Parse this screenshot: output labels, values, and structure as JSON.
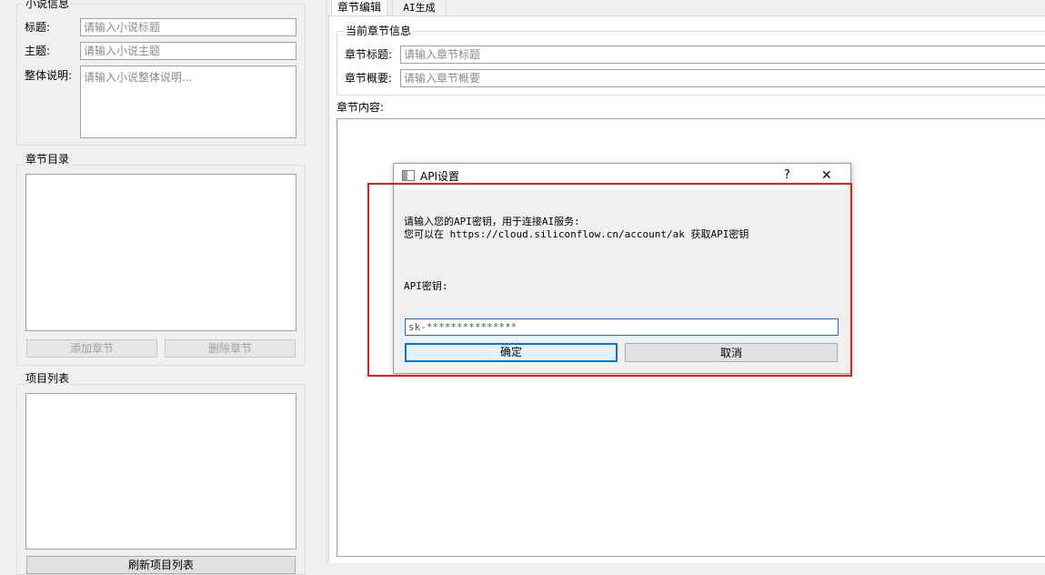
{
  "left_panel": {
    "novel_info": {
      "title": "小说信息",
      "title_label": "标题:",
      "title_placeholder": "请输入小说标题",
      "theme_label": "主题:",
      "theme_placeholder": "请输入小说主题",
      "desc_label": "整体说明:",
      "desc_placeholder": "请输入小说整体说明..."
    },
    "chapter_toc": {
      "title": "章节目录",
      "add_button": "添加章节",
      "delete_button": "删除章节"
    },
    "project_list": {
      "title": "项目列表",
      "bottom_button": "刷新项目列表"
    }
  },
  "right_panel": {
    "tabs": [
      {
        "label": "章节编辑",
        "active": true
      },
      {
        "label": "AI生成",
        "active": false
      }
    ],
    "current_chapter": {
      "title": "当前章节信息",
      "chapter_title_label": "章节标题:",
      "chapter_title_placeholder": "请输入章节标题",
      "chapter_summary_label": "章节概要:",
      "chapter_summary_placeholder": "请输入章节概要"
    },
    "content_label": "章节内容:"
  },
  "dialog": {
    "title": "API设置",
    "help_button": "?",
    "close_button": "✕",
    "message_line1": "请输入您的API密钥，用于连接AI服务:",
    "message_line2": "您可以在 https://cloud.siliconflow.cn/account/ak 获取API密钥",
    "key_label": "API密钥:",
    "key_value": "sk-***************",
    "ok_button": "确定",
    "cancel_button": "取消"
  },
  "highlight_color": "#e02020",
  "focus_color": "#0078d7"
}
